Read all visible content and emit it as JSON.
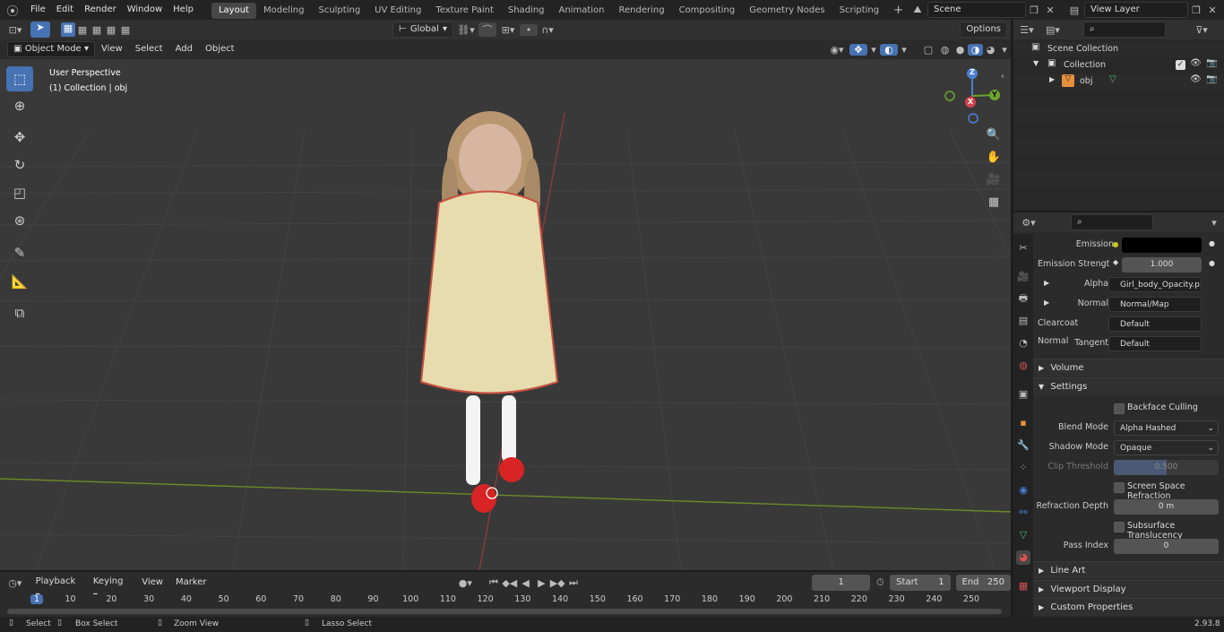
{
  "topbar": {
    "menus": [
      "File",
      "Edit",
      "Render",
      "Window",
      "Help"
    ],
    "workspaces": [
      "Layout",
      "Modeling",
      "Sculpting",
      "UV Editing",
      "Texture Paint",
      "Shading",
      "Animation",
      "Rendering",
      "Compositing",
      "Geometry Nodes",
      "Scripting"
    ],
    "active_workspace": "Layout",
    "add_tab": "+",
    "scene": "Scene",
    "view_layer": "View Layer"
  },
  "viewport_header": {
    "mode": "Object Mode",
    "menus": [
      "View",
      "Select",
      "Add",
      "Object"
    ],
    "orientation": "Global",
    "options": "Options"
  },
  "viewport": {
    "perspective": "User Perspective",
    "collection_info": "(1) Collection | obj",
    "gizmo": {
      "x": "X",
      "y": "Y",
      "z": "Z"
    }
  },
  "outliner": {
    "scene_collection": "Scene Collection",
    "collection": "Collection",
    "object": "obj"
  },
  "properties": {
    "emission_label": "Emission",
    "emission_strength_label": "Emission Strengt",
    "emission_strength": "1.000",
    "alpha_label": "Alpha",
    "alpha_value": "Girl_body_Opacity.p...",
    "normal_label": "Normal",
    "normal_value": "Normal/Map",
    "clearcoat_label": "Clearcoat Normal",
    "clearcoat_value": "Default",
    "tangent_label": "Tangent",
    "tangent_value": "Default",
    "volume": "Volume",
    "settings": "Settings",
    "backface": "Backface Culling",
    "blend_label": "Blend Mode",
    "blend_value": "Alpha Hashed",
    "shadow_label": "Shadow Mode",
    "shadow_value": "Opaque",
    "clip_label": "Clip Threshold",
    "clip_value": "0.500",
    "ssr": "Screen Space Refraction",
    "refraction_label": "Refraction Depth",
    "refraction_value": "0 m",
    "subsurface": "Subsurface Translucency",
    "pass_label": "Pass Index",
    "pass_value": "0",
    "line_art": "Line Art",
    "viewport_display": "Viewport Display",
    "custom_props": "Custom Properties",
    "colors": {
      "emission_dot": "#c8c818",
      "normal_dot": "#6363c7",
      "accent": "#4772b3"
    }
  },
  "timeline": {
    "menus": [
      "Playback",
      "Keying",
      "View",
      "Marker"
    ],
    "current_frame": "1",
    "start_label": "Start",
    "start": "1",
    "end_label": "End",
    "end": "250",
    "ticks": [
      "1",
      "10",
      "20",
      "30",
      "40",
      "50",
      "60",
      "70",
      "80",
      "90",
      "100",
      "110",
      "120",
      "130",
      "140",
      "150",
      "160",
      "170",
      "180",
      "190",
      "200",
      "210",
      "220",
      "230",
      "240",
      "250"
    ]
  },
  "status": {
    "select": "Select",
    "box_select": "Box Select",
    "zoom_view": "Zoom View",
    "lasso_select": "Lasso Select",
    "version": "2.93.8"
  }
}
